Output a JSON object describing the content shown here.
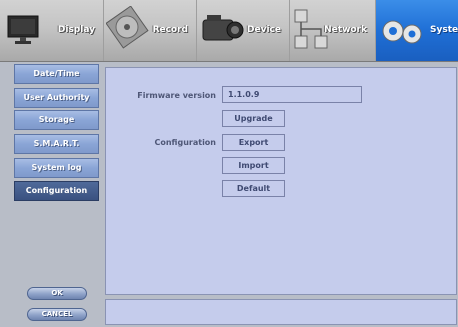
{
  "tabs": [
    {
      "label": "Display",
      "icon": "monitor-icon",
      "active": false
    },
    {
      "label": "Record",
      "icon": "record-disc-icon",
      "active": false
    },
    {
      "label": "Device",
      "icon": "camera-icon",
      "active": false
    },
    {
      "label": "Network",
      "icon": "network-icon",
      "active": false
    },
    {
      "label": "System",
      "icon": "gears-icon",
      "active": true
    }
  ],
  "sidebar": {
    "items": [
      {
        "label": "Date/Time",
        "active": false
      },
      {
        "label": "User Authority",
        "active": false
      },
      {
        "label": "Storage",
        "active": false
      },
      {
        "label": "S.M.A.R.T.",
        "active": false
      },
      {
        "label": "System log",
        "active": false
      },
      {
        "label": "Configuration",
        "active": true
      }
    ],
    "ok_label": "OK",
    "cancel_label": "CANCEL"
  },
  "main": {
    "firmware_label": "Firmware version",
    "firmware_value": "1.1.0.9",
    "upgrade_label": "Upgrade",
    "configuration_label": "Configuration",
    "export_label": "Export",
    "import_label": "Import",
    "default_label": "Default"
  },
  "colors": {
    "active_tab": "#1f6fd6",
    "sidebar_item": "#8aa5d6",
    "sidebar_active": "#3a5180",
    "panel_background": "#c5ccec",
    "frame_background": "#b8bdc7"
  }
}
